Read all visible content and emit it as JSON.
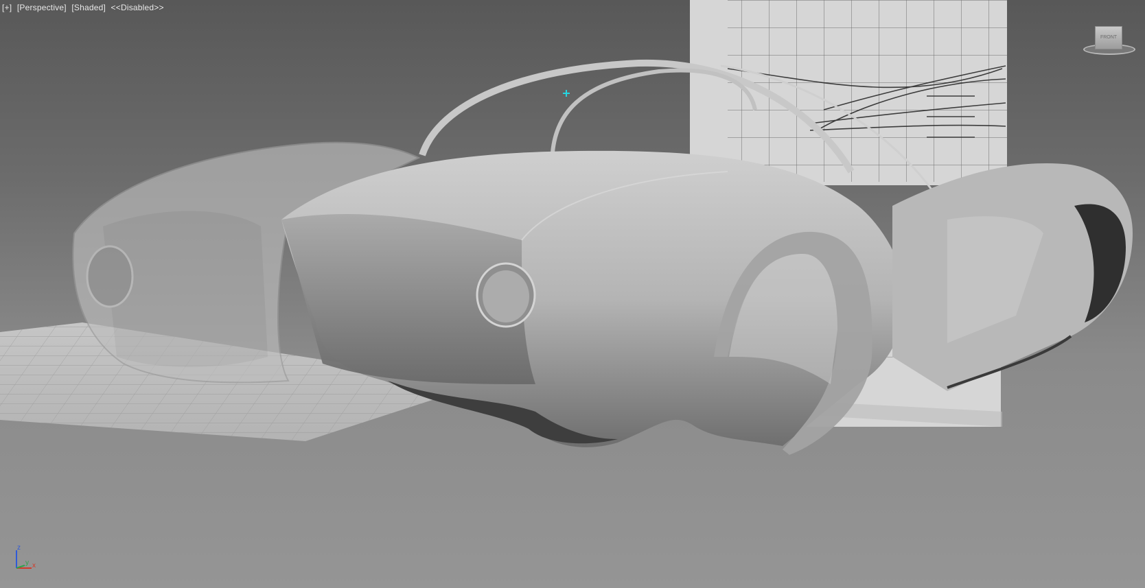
{
  "viewport": {
    "labels": [
      "[+]",
      "[Perspective]",
      "[Shaded]",
      "<<Disabled>>"
    ]
  },
  "viewcube": {
    "face_label": "FRONT"
  },
  "axes": {
    "z": "z",
    "y": "y",
    "x": "x"
  },
  "colors": {
    "crosshair": "#25d6e0",
    "axis_x": "#d23a2a",
    "axis_y": "#2fa24a",
    "axis_z": "#2f5ad8"
  }
}
